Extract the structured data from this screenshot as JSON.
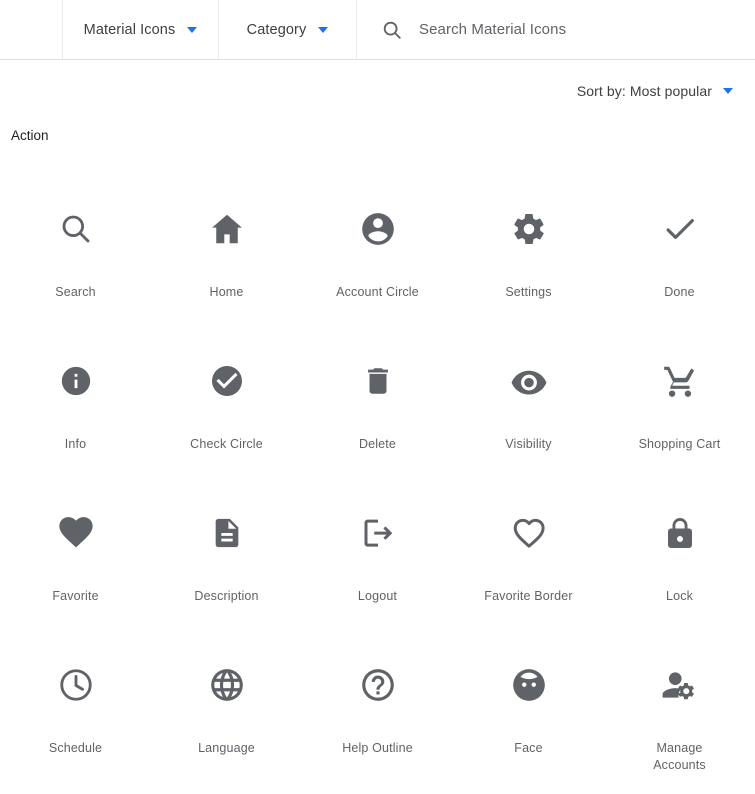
{
  "header": {
    "product_selector": {
      "label": "Material Icons",
      "icon": "chevron-down-icon"
    },
    "category_selector": {
      "label": "Category",
      "icon": "chevron-down-icon"
    },
    "search": {
      "icon": "search-icon",
      "placeholder": "Search Material Icons",
      "value": ""
    },
    "accent_color": "#1a73e8",
    "divider_color": "#e0e0e0"
  },
  "toolbar": {
    "sort_label": "Sort by: Most popular",
    "sort_icon": "chevron-down-icon"
  },
  "category": {
    "title": "Action"
  },
  "grid": {
    "icon_color": "#5f6368",
    "label_color": "#5f6368",
    "columns": 5,
    "items": [
      {
        "label": "Search",
        "icon": "search-icon"
      },
      {
        "label": "Home",
        "icon": "home-icon"
      },
      {
        "label": "Account Circle",
        "icon": "account-circle-icon"
      },
      {
        "label": "Settings",
        "icon": "gear-icon"
      },
      {
        "label": "Done",
        "icon": "check-icon"
      },
      {
        "label": "Info",
        "icon": "info-filled-icon"
      },
      {
        "label": "Check Circle",
        "icon": "check-circle-filled-icon"
      },
      {
        "label": "Delete",
        "icon": "trash-icon"
      },
      {
        "label": "Visibility",
        "icon": "eye-icon"
      },
      {
        "label": "Shopping Cart",
        "icon": "shopping-cart-icon"
      },
      {
        "label": "Favorite",
        "icon": "heart-filled-icon"
      },
      {
        "label": "Description",
        "icon": "document-icon"
      },
      {
        "label": "Logout",
        "icon": "logout-icon"
      },
      {
        "label": "Favorite Border",
        "icon": "heart-outline-icon"
      },
      {
        "label": "Lock",
        "icon": "lock-icon"
      },
      {
        "label": "Schedule",
        "icon": "clock-icon"
      },
      {
        "label": "Language",
        "icon": "globe-icon"
      },
      {
        "label": "Help Outline",
        "icon": "help-outline-icon"
      },
      {
        "label": "Face",
        "icon": "face-icon"
      },
      {
        "label": "Manage Accounts",
        "icon": "manage-accounts-icon"
      }
    ]
  }
}
